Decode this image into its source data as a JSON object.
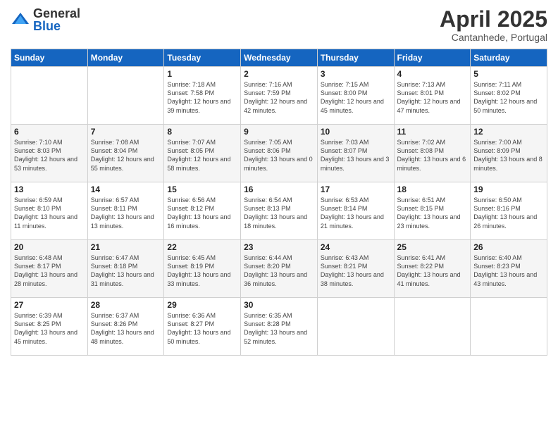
{
  "logo": {
    "general": "General",
    "blue": "Blue"
  },
  "header": {
    "month": "April 2025",
    "location": "Cantanhede, Portugal"
  },
  "weekdays": [
    "Sunday",
    "Monday",
    "Tuesday",
    "Wednesday",
    "Thursday",
    "Friday",
    "Saturday"
  ],
  "weeks": [
    [
      {
        "day": "",
        "info": ""
      },
      {
        "day": "",
        "info": ""
      },
      {
        "day": "1",
        "info": "Sunrise: 7:18 AM\nSunset: 7:58 PM\nDaylight: 12 hours and 39 minutes."
      },
      {
        "day": "2",
        "info": "Sunrise: 7:16 AM\nSunset: 7:59 PM\nDaylight: 12 hours and 42 minutes."
      },
      {
        "day": "3",
        "info": "Sunrise: 7:15 AM\nSunset: 8:00 PM\nDaylight: 12 hours and 45 minutes."
      },
      {
        "day": "4",
        "info": "Sunrise: 7:13 AM\nSunset: 8:01 PM\nDaylight: 12 hours and 47 minutes."
      },
      {
        "day": "5",
        "info": "Sunrise: 7:11 AM\nSunset: 8:02 PM\nDaylight: 12 hours and 50 minutes."
      }
    ],
    [
      {
        "day": "6",
        "info": "Sunrise: 7:10 AM\nSunset: 8:03 PM\nDaylight: 12 hours and 53 minutes."
      },
      {
        "day": "7",
        "info": "Sunrise: 7:08 AM\nSunset: 8:04 PM\nDaylight: 12 hours and 55 minutes."
      },
      {
        "day": "8",
        "info": "Sunrise: 7:07 AM\nSunset: 8:05 PM\nDaylight: 12 hours and 58 minutes."
      },
      {
        "day": "9",
        "info": "Sunrise: 7:05 AM\nSunset: 8:06 PM\nDaylight: 13 hours and 0 minutes."
      },
      {
        "day": "10",
        "info": "Sunrise: 7:03 AM\nSunset: 8:07 PM\nDaylight: 13 hours and 3 minutes."
      },
      {
        "day": "11",
        "info": "Sunrise: 7:02 AM\nSunset: 8:08 PM\nDaylight: 13 hours and 6 minutes."
      },
      {
        "day": "12",
        "info": "Sunrise: 7:00 AM\nSunset: 8:09 PM\nDaylight: 13 hours and 8 minutes."
      }
    ],
    [
      {
        "day": "13",
        "info": "Sunrise: 6:59 AM\nSunset: 8:10 PM\nDaylight: 13 hours and 11 minutes."
      },
      {
        "day": "14",
        "info": "Sunrise: 6:57 AM\nSunset: 8:11 PM\nDaylight: 13 hours and 13 minutes."
      },
      {
        "day": "15",
        "info": "Sunrise: 6:56 AM\nSunset: 8:12 PM\nDaylight: 13 hours and 16 minutes."
      },
      {
        "day": "16",
        "info": "Sunrise: 6:54 AM\nSunset: 8:13 PM\nDaylight: 13 hours and 18 minutes."
      },
      {
        "day": "17",
        "info": "Sunrise: 6:53 AM\nSunset: 8:14 PM\nDaylight: 13 hours and 21 minutes."
      },
      {
        "day": "18",
        "info": "Sunrise: 6:51 AM\nSunset: 8:15 PM\nDaylight: 13 hours and 23 minutes."
      },
      {
        "day": "19",
        "info": "Sunrise: 6:50 AM\nSunset: 8:16 PM\nDaylight: 13 hours and 26 minutes."
      }
    ],
    [
      {
        "day": "20",
        "info": "Sunrise: 6:48 AM\nSunset: 8:17 PM\nDaylight: 13 hours and 28 minutes."
      },
      {
        "day": "21",
        "info": "Sunrise: 6:47 AM\nSunset: 8:18 PM\nDaylight: 13 hours and 31 minutes."
      },
      {
        "day": "22",
        "info": "Sunrise: 6:45 AM\nSunset: 8:19 PM\nDaylight: 13 hours and 33 minutes."
      },
      {
        "day": "23",
        "info": "Sunrise: 6:44 AM\nSunset: 8:20 PM\nDaylight: 13 hours and 36 minutes."
      },
      {
        "day": "24",
        "info": "Sunrise: 6:43 AM\nSunset: 8:21 PM\nDaylight: 13 hours and 38 minutes."
      },
      {
        "day": "25",
        "info": "Sunrise: 6:41 AM\nSunset: 8:22 PM\nDaylight: 13 hours and 41 minutes."
      },
      {
        "day": "26",
        "info": "Sunrise: 6:40 AM\nSunset: 8:23 PM\nDaylight: 13 hours and 43 minutes."
      }
    ],
    [
      {
        "day": "27",
        "info": "Sunrise: 6:39 AM\nSunset: 8:25 PM\nDaylight: 13 hours and 45 minutes."
      },
      {
        "day": "28",
        "info": "Sunrise: 6:37 AM\nSunset: 8:26 PM\nDaylight: 13 hours and 48 minutes."
      },
      {
        "day": "29",
        "info": "Sunrise: 6:36 AM\nSunset: 8:27 PM\nDaylight: 13 hours and 50 minutes."
      },
      {
        "day": "30",
        "info": "Sunrise: 6:35 AM\nSunset: 8:28 PM\nDaylight: 13 hours and 52 minutes."
      },
      {
        "day": "",
        "info": ""
      },
      {
        "day": "",
        "info": ""
      },
      {
        "day": "",
        "info": ""
      }
    ]
  ]
}
